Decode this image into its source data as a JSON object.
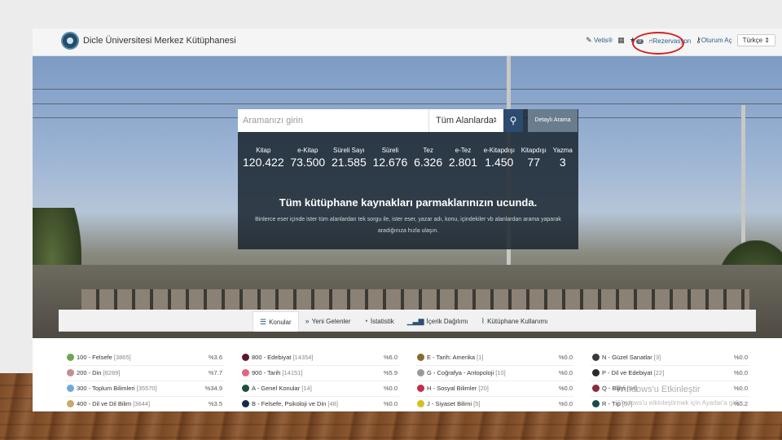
{
  "header": {
    "site_title": "Dicle Üniversitesi Merkez Kütüphanesi",
    "links": {
      "vetis": "Vetis®",
      "badge_count": "0",
      "reservation": "Rezervasyon",
      "login": "Oturum Aç"
    },
    "language": "Türkçe"
  },
  "search": {
    "placeholder": "Aramanızı girin",
    "scope": "Tüm Alanlarda",
    "advanced": "Detaylı Arama"
  },
  "stats": [
    {
      "label": "Kitap",
      "value": "120.422"
    },
    {
      "label": "e-Kitap",
      "value": "73.500"
    },
    {
      "label": "Süreli Sayı",
      "value": "21.585"
    },
    {
      "label": "Süreli",
      "value": "12.676"
    },
    {
      "label": "Tez",
      "value": "6.326"
    },
    {
      "label": "e-Tez",
      "value": "2.801"
    },
    {
      "label": "e-Kitapdışı",
      "value": "1.450"
    },
    {
      "label": "Kitapdışı",
      "value": "77"
    },
    {
      "label": "Yazma",
      "value": "3"
    }
  ],
  "hero": {
    "tagline": "Tüm kütüphane kaynakları parmaklarınızın ucunda.",
    "description": "Binlerce eser içinde ister tüm alanlardan tek sorgu ile, ister eser, yazar adı, konu, içindekiler vb alanlardan arama yaparak aradığınıza hızla ulaşın."
  },
  "tabs": [
    {
      "label": "Konular",
      "icon": "list-icon"
    },
    {
      "label": "Yeni Gelenler",
      "icon": "double-chevron-icon"
    },
    {
      "label": "İstatistik",
      "icon": "pie-icon"
    },
    {
      "label": "İçerik Dağılımı",
      "icon": "bars-icon"
    },
    {
      "label": "Kütüphane Kullanımı",
      "icon": "line-chart-icon"
    }
  ],
  "subjects": [
    [
      {
        "name": "100 - Felsefe",
        "count": "[3865]",
        "pct": "%3.6",
        "color": "#6aa84f"
      },
      {
        "name": "200 - Din",
        "count": "[8289]",
        "pct": "%7.7",
        "color": "#c98b8b"
      },
      {
        "name": "300 - Toplum Bilimleri",
        "count": "[35570]",
        "pct": "%34.9",
        "color": "#6fa8dc"
      },
      {
        "name": "400 - Dil ve Dil Bilim",
        "count": "[3644]",
        "pct": "%3.5",
        "color": "#c9a86b"
      }
    ],
    [
      {
        "name": "800 - Edebiyat",
        "count": "[14354]",
        "pct": "%6.0",
        "color": "#5b1530"
      },
      {
        "name": "900 - Tarih",
        "count": "[14151]",
        "pct": "%5.9",
        "color": "#e06680"
      },
      {
        "name": "A - Genel Konular",
        "count": "[14]",
        "pct": "%0.0",
        "color": "#1f4e3d"
      },
      {
        "name": "B - Felsefe, Psikoloji ve Din",
        "count": "[48]",
        "pct": "%0.0",
        "color": "#1a2a4a"
      }
    ],
    [
      {
        "name": "E - Tarih: Amerika",
        "count": "[1]",
        "pct": "%0.0",
        "color": "#8a6a2a"
      },
      {
        "name": "G - Coğrafya - Antopoloji",
        "count": "[10]",
        "pct": "%0.0",
        "color": "#9a9a9a"
      },
      {
        "name": "H - Sosyal Bilimler",
        "count": "[20]",
        "pct": "%0.0",
        "color": "#c0304a"
      },
      {
        "name": "J - Siyaset Bilimi",
        "count": "[5]",
        "pct": "%0.0",
        "color": "#d4c020"
      }
    ],
    [
      {
        "name": "N - Güzel Sanatlar",
        "count": "[3]",
        "pct": "%0.0",
        "color": "#3a3a3a"
      },
      {
        "name": "P - Dil ve Edebiyat",
        "count": "[22]",
        "pct": "%0.0",
        "color": "#2a2a2a"
      },
      {
        "name": "Q - Bilim",
        "count": "[94]",
        "pct": "%0.0",
        "color": "#8a2a3a"
      },
      {
        "name": "R - Tıp",
        "count": "[57]",
        "pct": "%0.2",
        "color": "#1a4a4a"
      }
    ]
  ],
  "watermark": {
    "line1": "Windows'u Etkinleştir",
    "line2": "Windows'u etkinleştirmek için Ayarlar'a gidin."
  },
  "colors": {
    "accent": "#2c4b6e",
    "annotation": "#d42020"
  }
}
